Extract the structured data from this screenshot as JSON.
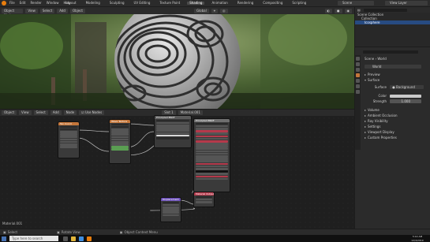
{
  "topbar": {
    "menu": [
      "File",
      "Edit",
      "Render",
      "Window",
      "Help"
    ],
    "tabs": [
      "Layout",
      "Modeling",
      "Sculpting",
      "UV Editing",
      "Texture Paint",
      "Shading",
      "Animation",
      "Rendering",
      "Compositing",
      "Scripting"
    ],
    "active_tab": "Shading",
    "scene": "Scene",
    "view_layer": "View Layer"
  },
  "viewport": {
    "mode": "Object Mode",
    "menu": [
      "View",
      "Select",
      "Add",
      "Object"
    ],
    "shading": "Global"
  },
  "outliner": {
    "items": [
      "Scene Collection",
      "Collection",
      "Icosphere"
    ]
  },
  "properties": {
    "tabs": [
      "Scene",
      "World"
    ],
    "world_name": "World",
    "sections": [
      "Preview",
      "Surface"
    ],
    "surface_label": "Surface",
    "surface_value": "Background",
    "color_label": "Color",
    "strength_label": "Strength",
    "strength_value": "1.000",
    "panels": [
      "Volume",
      "Ambient Occlusion",
      "Ray Visibility",
      "Settings",
      "Viewport Display",
      "Custom Properties"
    ]
  },
  "node_editor": {
    "header_items": [
      "Object",
      "View",
      "Select",
      "Add",
      "Node",
      "Use Nodes"
    ],
    "slot": "Slot 1",
    "material": "Material.001",
    "nodes": [
      {
        "title": "Tex Coord",
        "color": "#c4763a"
      },
      {
        "title": "Wave Texture",
        "color": "#c4763a"
      },
      {
        "title": "Principled BSDF",
        "color": "#6f6f6f"
      },
      {
        "title": "Material Output",
        "color": "#b5394b"
      },
      {
        "title": "Displacement",
        "color": "#6b4fb8"
      }
    ],
    "footer_label": "Material.001"
  },
  "statusbar": {
    "select": "Select",
    "box": "Rotate View",
    "menu": "Object Context Menu"
  },
  "taskbar": {
    "search_placeholder": "Type here to search",
    "time": "5:14 AM",
    "date": "12/4/2019"
  },
  "colors": {
    "accent": "#4772b3",
    "node_header_texture": "#c4763a",
    "node_header_output": "#b5394b",
    "node_header_vector": "#6b4fb8",
    "selected_row": "#274b82"
  }
}
